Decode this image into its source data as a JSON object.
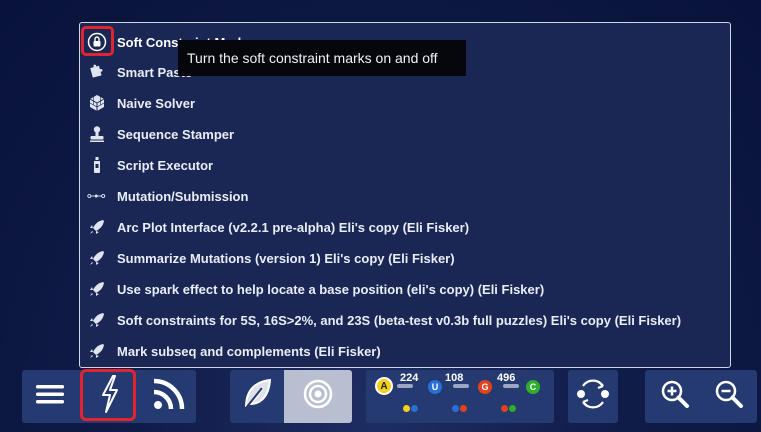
{
  "menu": {
    "items": [
      {
        "label": "Soft Constraint Marker",
        "icon": "lock-icon"
      },
      {
        "label": "Smart Paste",
        "icon": "puzzle-icon"
      },
      {
        "label": "Naive Solver",
        "icon": "cube-icon"
      },
      {
        "label": "Sequence Stamper",
        "icon": "stamp-icon"
      },
      {
        "label": "Script Executor",
        "icon": "bottle-icon"
      },
      {
        "label": "Mutation/Submission",
        "icon": "nodes-icon"
      },
      {
        "label": "Arc Plot Interface (v2.2.1 pre-alpha) Eli's copy (Eli Fisker)",
        "icon": "rocket-icon"
      },
      {
        "label": "Summarize Mutations (version 1) Eli's copy (Eli Fisker)",
        "icon": "rocket-icon"
      },
      {
        "label": "Use spark effect to help locate a base position (eli's copy) (Eli Fisker)",
        "icon": "rocket-icon"
      },
      {
        "label": "Soft constraints for 5S, 16S>2%, and 23S (beta-test v0.3b full puzzles) Eli's copy (Eli Fisker)",
        "icon": "rocket-icon"
      },
      {
        "label": "Mark subseq and complements  (Eli Fisker)",
        "icon": "rocket-icon"
      }
    ]
  },
  "tooltip": {
    "text": "Turn the soft constraint marks on and off"
  },
  "toolbar": {
    "pairs": {
      "au": {
        "letter_a": "A",
        "letter_u": "U",
        "count": "224"
      },
      "gu": {
        "letter_g": "G",
        "count": "108"
      },
      "gc": {
        "letter_c": "C",
        "count": "496"
      }
    }
  },
  "colors": {
    "highlight": "#e2242f",
    "menu_bg": "#1a2755",
    "toolbar_bg": "#263a72",
    "base_a": "#f2d21b",
    "base_u": "#2a6fd6",
    "base_g": "#e0421e",
    "base_c": "#2fae2a"
  }
}
